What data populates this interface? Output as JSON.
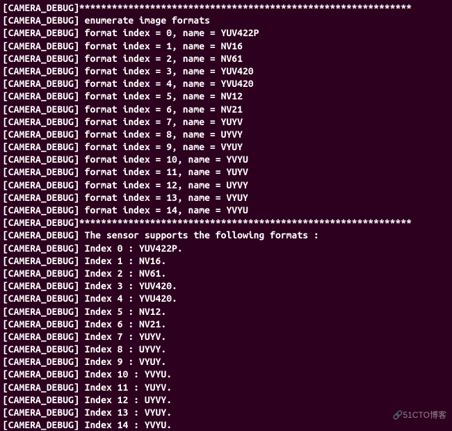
{
  "prefix": "[CAMERA_DEBUG]",
  "separator": "*************************************************************",
  "enumerate_header": "enumerate image formats",
  "formats": [
    {
      "index": 0,
      "name": "YUV422P"
    },
    {
      "index": 1,
      "name": "NV16"
    },
    {
      "index": 2,
      "name": "NV61"
    },
    {
      "index": 3,
      "name": "YUV420"
    },
    {
      "index": 4,
      "name": "YVU420"
    },
    {
      "index": 5,
      "name": "NV12"
    },
    {
      "index": 6,
      "name": "NV21"
    },
    {
      "index": 7,
      "name": "YUYV"
    },
    {
      "index": 8,
      "name": "UYVY"
    },
    {
      "index": 9,
      "name": "VYUY"
    },
    {
      "index": 10,
      "name": "YVYU"
    },
    {
      "index": 11,
      "name": "YUYV"
    },
    {
      "index": 12,
      "name": "UYVY"
    },
    {
      "index": 13,
      "name": "VYUY"
    },
    {
      "index": 14,
      "name": "YVYU"
    }
  ],
  "sensor_header": "The sensor supports the following formats :",
  "sensor_formats": [
    {
      "index": 0,
      "name": "YUV422P"
    },
    {
      "index": 1,
      "name": "NV16"
    },
    {
      "index": 2,
      "name": "NV61"
    },
    {
      "index": 3,
      "name": "YUV420"
    },
    {
      "index": 4,
      "name": "YVU420"
    },
    {
      "index": 5,
      "name": "NV12"
    },
    {
      "index": 6,
      "name": "NV21"
    },
    {
      "index": 7,
      "name": "YUYV"
    },
    {
      "index": 8,
      "name": "UYVY"
    },
    {
      "index": 9,
      "name": "VYUY"
    },
    {
      "index": 10,
      "name": "YVYU"
    },
    {
      "index": 11,
      "name": "YUYV"
    },
    {
      "index": 12,
      "name": "UYVY"
    },
    {
      "index": 13,
      "name": "VYUY"
    },
    {
      "index": 14,
      "name": "YVYU"
    }
  ],
  "watermark": "🔗51CTO博客"
}
